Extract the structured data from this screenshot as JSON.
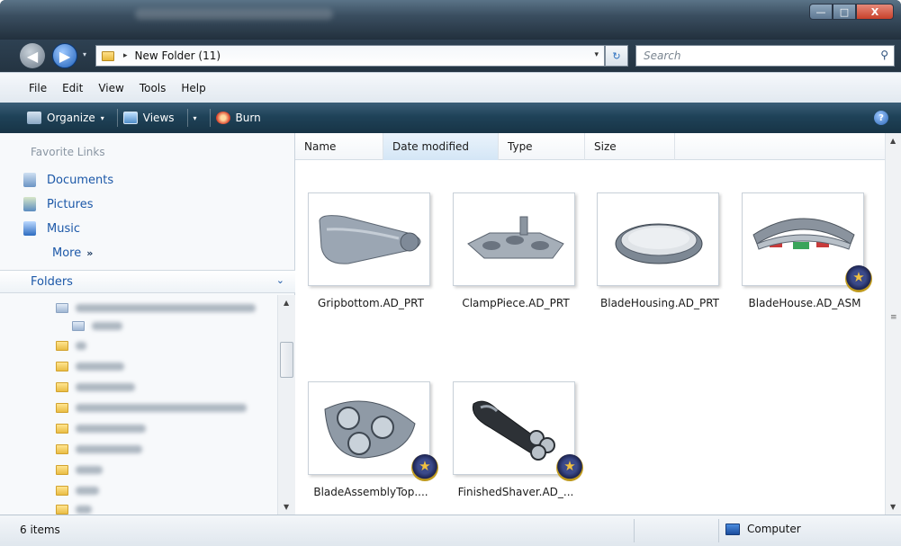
{
  "window": {
    "min_label": "—",
    "max_label": "□",
    "close_label": "X"
  },
  "nav": {
    "back_glyph": "◀",
    "forward_glyph": "▶",
    "recent_glyph": "▾"
  },
  "address": {
    "arrow": "▸",
    "path": "New Folder (11)",
    "dropdown": "▾",
    "refresh": "↻"
  },
  "search": {
    "placeholder": "Search",
    "icon": "search-icon"
  },
  "menu": [
    "File",
    "Edit",
    "View",
    "Tools",
    "Help"
  ],
  "toolbar": {
    "organize": "Organize",
    "views": "Views",
    "burn": "Burn",
    "caret": "▾",
    "help": "?"
  },
  "favorites": {
    "title": "Favorite Links",
    "items": [
      {
        "label": "Documents",
        "icon": "documents-icon"
      },
      {
        "label": "Pictures",
        "icon": "pictures-icon"
      },
      {
        "label": "Music",
        "icon": "music-icon"
      }
    ],
    "more": "More",
    "more_glyph": "»"
  },
  "folders": {
    "label": "Folders",
    "chevron": "⌄"
  },
  "columns": [
    "Name",
    "Date modified",
    "Type",
    "Size"
  ],
  "files": [
    {
      "name": "Gripbottom.AD_PRT",
      "badge": false
    },
    {
      "name": "ClampPiece.AD_PRT",
      "badge": false
    },
    {
      "name": "BladeHousing.AD_PRT",
      "badge": false
    },
    {
      "name": "BladeHouse.AD_ASM",
      "badge": true
    },
    {
      "name": "BladeAssemblyTop....",
      "badge": true
    },
    {
      "name": "FinishedShaver.AD_...",
      "badge": true
    }
  ],
  "status": {
    "count": "6 items",
    "location": "Computer"
  },
  "colors": {
    "link": "#1c58a8",
    "toolbar": "#1f4258",
    "title": "#3a4e60"
  }
}
